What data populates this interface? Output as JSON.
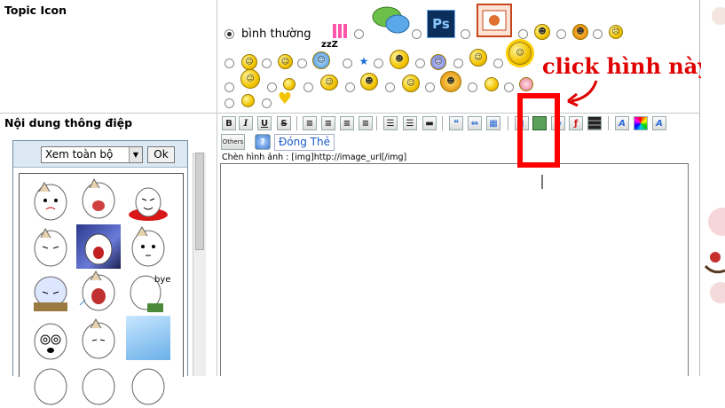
{
  "topic_icon": {
    "label": "Topic Icon",
    "default_option": "bình thường",
    "selected": "bình thường",
    "icons_row1": [
      "pink-grid-icon",
      "chat-bubbles-icon",
      "photoshop-icon",
      "powerpoint-icon",
      "grin-smiley-icon",
      "devil-smiley-icon",
      "sad-smiley-icon"
    ],
    "icons_row2": [
      "smile-icon",
      "wink-smiley-icon",
      "sleepy-smiley-icon",
      "star-icon",
      "glasses-smiley-icon",
      "confused-smiley-icon",
      "thumbs-smiley-icon",
      "sun-smiley-icon"
    ],
    "icons_row3": [
      "reading-smiley-icon",
      "mini-smiley-icon",
      "pointing-smiley-icon",
      "yay-smiley-icon",
      "sick-smiley-icon",
      "crazy-smiley-icon",
      "big-smile-icon",
      "pink-face-icon"
    ],
    "icons_row4": [
      "tiny-smiley-icon",
      "heart-smiley-icon"
    ],
    "ps_text": "Ps"
  },
  "message": {
    "label": "Nội dung thông điệp",
    "select_value": "Xem toàn bộ",
    "ok_label": "Ok",
    "sleep_text": "zzZ"
  },
  "toolbar": {
    "bold": "B",
    "italic": "I",
    "underline": "U",
    "strike": "S",
    "others": "Others",
    "help": "?",
    "close_tags": "Đóng Thẻ",
    "hint": "Chèn hình ảnh : [img]http://image_url[/img]"
  },
  "annotation": {
    "text": "click hình này",
    "color": "#e00000"
  },
  "stickers": {
    "bye_text": "bye"
  }
}
